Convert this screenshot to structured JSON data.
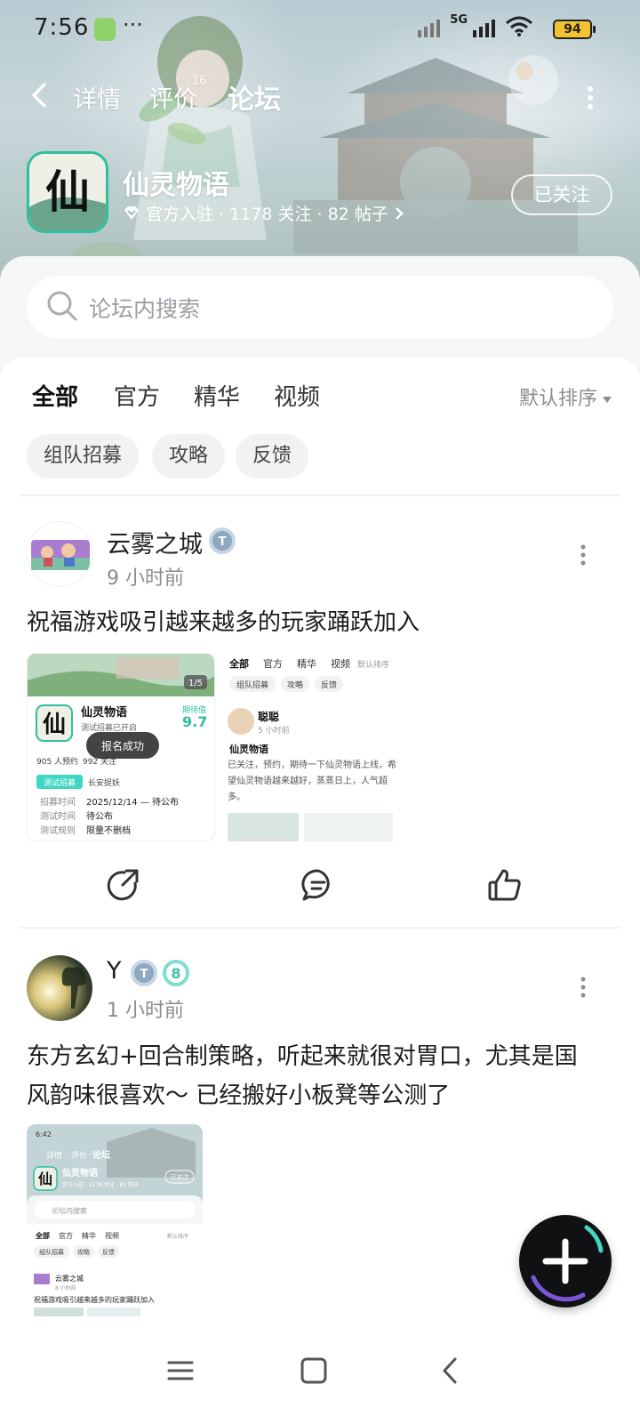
{
  "status_bar": {
    "time": "7:56",
    "more": "···",
    "network": "5G",
    "battery": "94"
  },
  "nav": {
    "tabs": [
      {
        "label": "详情"
      },
      {
        "label": "评价",
        "count": "16"
      },
      {
        "label": "论坛",
        "active": true
      }
    ]
  },
  "game": {
    "icon_char": "仙",
    "title": "仙灵物语",
    "meta": "官方入驻 · 1178 关注 · 82 帖子",
    "follow_label": "已关注"
  },
  "search": {
    "placeholder": "论坛内搜索"
  },
  "filters": {
    "tabs": [
      "全部",
      "官方",
      "精华",
      "视频"
    ],
    "active": "全部",
    "sort_label": "默认排序"
  },
  "chips": [
    "组队招募",
    "攻略",
    "反馈"
  ],
  "posts": [
    {
      "user": "云雾之城",
      "time": "9 小时前",
      "text": "祝福游戏吸引越来越多的玩家踊跃加入",
      "images": [
        {
          "counter": "1/5",
          "title": "仙灵物语",
          "subtitle": "测试招募已开启",
          "expect_label": "期待值",
          "expect_value": "9.7",
          "reserve": "905 人预约",
          "follow": "992 关注",
          "toast": "报名成功",
          "tag": "测试招募",
          "tag2": "长安捉妖",
          "rows": [
            [
              "招募时间",
              "2025/12/14 — 待公布"
            ],
            [
              "测试时间",
              "待公布"
            ],
            [
              "测试规则",
              "限量不删档"
            ]
          ]
        },
        {
          "tabs": [
            "全部",
            "官方",
            "精华",
            "视频"
          ],
          "sort": "默认排序",
          "chips": [
            "组队招募",
            "攻略",
            "反馈"
          ],
          "user": "聪聪",
          "time": "5 小时前",
          "post_title": "仙灵物语",
          "post_text": "已关注，预约，期待一下仙灵物语上线，希望仙灵物语越来越好，蒸蒸日上，人气超多。"
        }
      ]
    },
    {
      "user": "Y",
      "level": "8",
      "time": "1 小时前",
      "text_line1": "东方玄幻+回合制策略，听起来就很对胃口，尤其是国",
      "text_line2": "风韵味很喜欢～ 已经搬好小板凳等公测了",
      "image": {
        "time": "6:42",
        "tabs": [
          "详情",
          "评价",
          "论坛"
        ],
        "title": "仙灵物语",
        "meta": "官方入驻 · 1178 关注 · 81 帖子",
        "follow": "已关注",
        "search": "论坛内搜索",
        "ftabs": [
          "全部",
          "官方",
          "精华",
          "视频"
        ],
        "sort": "默认排序",
        "chips": [
          "组队招募",
          "攻略",
          "反馈"
        ],
        "user": "云雾之城",
        "utime": "8 小时前",
        "text": "祝福游戏吸引越来越多的玩家踊跃加入"
      }
    }
  ],
  "colors": {
    "accent": "#3fd6c4",
    "text": "#1c1c1c",
    "muted": "#8a8d91"
  }
}
